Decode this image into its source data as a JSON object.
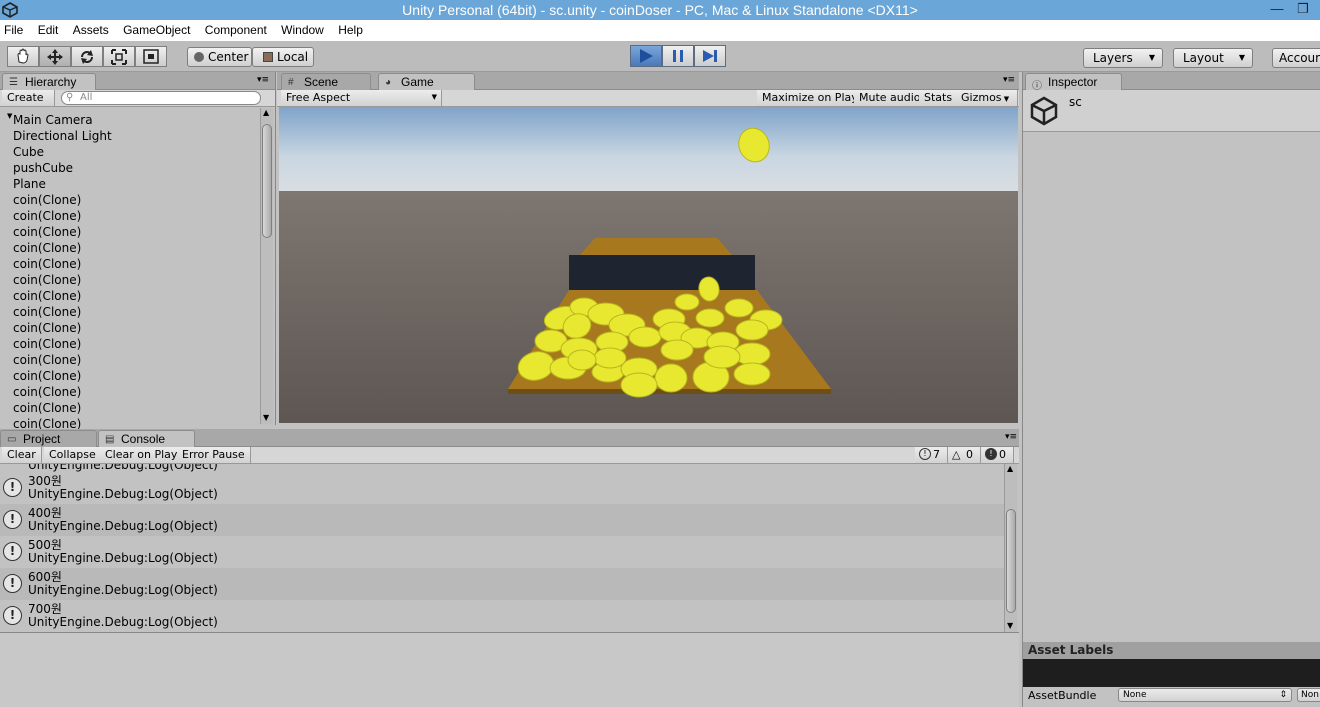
{
  "window": {
    "title": "Unity Personal (64bit) - sc.unity - coinDoser - PC, Mac & Linux Standalone <DX11>",
    "minimize_glyph": "—",
    "restore_glyph": "❐"
  },
  "menu": [
    "File",
    "Edit",
    "Assets",
    "GameObject",
    "Component",
    "Window",
    "Help"
  ],
  "toolbar": {
    "tools": [
      "hand-tool-icon",
      "move-tool-icon",
      "rotate-tool-icon",
      "scale-tool-icon",
      "rect-tool-icon"
    ],
    "pivot_label": "Center",
    "space_label": "Local",
    "layers_label": "Layers",
    "layout_label": "Layout",
    "account_label": "Accoun"
  },
  "hierarchy": {
    "tab_label": "Hierarchy",
    "create_label": "Create",
    "search_placeholder": "All",
    "items": [
      "Main Camera",
      "Directional Light",
      "Cube",
      "pushCube",
      "Plane",
      "coin(Clone)",
      "coin(Clone)",
      "coin(Clone)",
      "coin(Clone)",
      "coin(Clone)",
      "coin(Clone)",
      "coin(Clone)",
      "coin(Clone)",
      "coin(Clone)",
      "coin(Clone)",
      "coin(Clone)",
      "coin(Clone)",
      "coin(Clone)",
      "coin(Clone)",
      "coin(Clone)"
    ]
  },
  "scene_tab": "Scene",
  "game": {
    "tab_label": "Game",
    "aspect_label": "Free Aspect",
    "maximize_label": "Maximize on Play",
    "mute_label": "Mute audio",
    "stats_label": "Stats",
    "gizmos_label": "Gizmos"
  },
  "inspector": {
    "tab_label": "Inspector",
    "asset_name": "sc",
    "asset_labels_title": "Asset Labels",
    "assetbundle_label": "AssetBundle",
    "assetbundle_value": "None",
    "variant_value": "Non"
  },
  "project_tab": "Project",
  "console": {
    "tab_label": "Console",
    "buttons": [
      "Clear",
      "Collapse",
      "Clear on Play",
      "Error Pause"
    ],
    "counts": {
      "info": "7",
      "warning": "0",
      "error": "0"
    },
    "partial_line": "UnityEngine.Debug:Log(Object)",
    "entries": [
      {
        "message": "300원",
        "trace": "UnityEngine.Debug:Log(Object)"
      },
      {
        "message": "400원",
        "trace": "UnityEngine.Debug:Log(Object)"
      },
      {
        "message": "500원",
        "trace": "UnityEngine.Debug:Log(Object)"
      },
      {
        "message": "600원",
        "trace": "UnityEngine.Debug:Log(Object)"
      },
      {
        "message": "700원",
        "trace": "UnityEngine.Debug:Log(Object)"
      }
    ]
  },
  "colors": {
    "title_bar": "#6aa6d8",
    "play_active": "#4a79b8",
    "coin": "#e8e830",
    "board": "#a8781e"
  }
}
